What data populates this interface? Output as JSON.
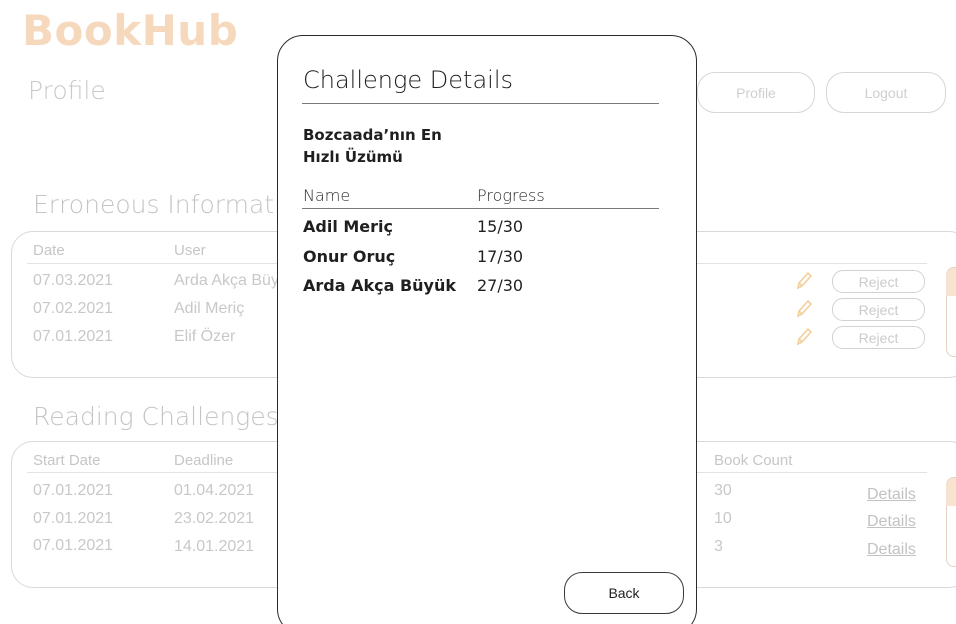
{
  "app": {
    "brand": "BookHub",
    "page_title": "Profile"
  },
  "header": {
    "profile_label": "Profile",
    "logout_label": "Logout"
  },
  "erroneous": {
    "title": "Erroneous Information",
    "columns": [
      "Date",
      "User"
    ],
    "rows": [
      {
        "date": "07.03.2021",
        "user": "Arda Akça Büyük",
        "action": "Reject"
      },
      {
        "date": "07.02.2021",
        "user": "Adil Meriç",
        "action": "Reject"
      },
      {
        "date": "07.01.2021",
        "user": "Elif Özer",
        "action": "Reject"
      }
    ]
  },
  "challenges": {
    "title": "Reading Challenges",
    "columns": [
      "Start Date",
      "Deadline",
      "Book Count"
    ],
    "rows": [
      {
        "start": "07.01.2021",
        "deadline": "01.04.2021",
        "count": "30",
        "action": "Details"
      },
      {
        "start": "07.01.2021",
        "deadline": "23.02.2021",
        "count": "10",
        "action": "Details"
      },
      {
        "start": "07.01.2021",
        "deadline": "14.01.2021",
        "count": "3",
        "action": "Details"
      }
    ]
  },
  "modal": {
    "title": "Challenge Details",
    "challenge_name": "Bozcaada’nın En Hızlı Üzümü",
    "columns": {
      "name": "Name",
      "progress": "Progress"
    },
    "participants": [
      {
        "name": "Adil Meriç",
        "progress": "15/30"
      },
      {
        "name": "Onur Oruç",
        "progress": "17/30"
      },
      {
        "name": "Arda Akça Büyük",
        "progress": "27/30"
      }
    ],
    "back_label": "Back"
  },
  "colors": {
    "brand": "#f6d9bd",
    "edit_icon": "#f3cf9a"
  },
  "icons": {
    "edit": "pencil-icon"
  }
}
